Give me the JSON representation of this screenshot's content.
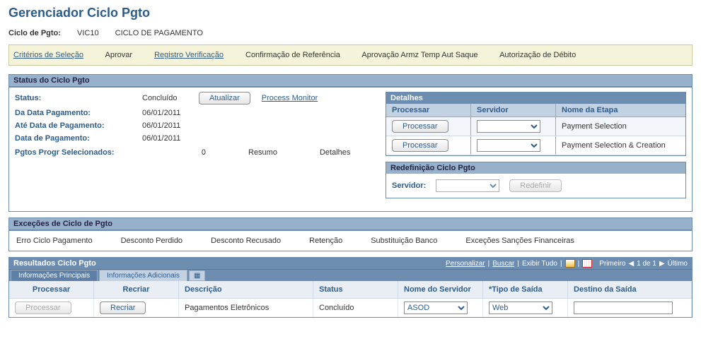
{
  "page": {
    "title": "Gerenciador Ciclo Pgto"
  },
  "cycle": {
    "label": "Ciclo de Pgto:",
    "code": "VIC10",
    "desc": "CICLO DE PAGAMENTO"
  },
  "tabs": {
    "criterios": "Critérios de Seleção",
    "aprovar": "Aprovar",
    "registro": "Registro Verificação",
    "confirmacao": "Confirmação de Referência",
    "aprovacao_armz": "Aprovação Armz Temp Aut Saque",
    "autorizacao_debito": "Autorização de Débito"
  },
  "status": {
    "header": "Status do Ciclo Pgto",
    "labels": {
      "status": "Status:",
      "da_data": "Da Data Pagamento:",
      "ate_data": "Até Data de Pagamento:",
      "data": "Data de Pagamento:",
      "pgtos_progr": "Pgtos Progr Selecionados:"
    },
    "values": {
      "status": "Concluído",
      "da_data": "06/01/2011",
      "ate_data": "06/01/2011",
      "data": "06/01/2011",
      "pgtos_progr": "0"
    },
    "atualizar_label": "Atualizar",
    "process_monitor": "Process Monitor",
    "resumo": "Resumo",
    "detalhes": "Detalhes"
  },
  "details": {
    "header": "Detalhes",
    "cols": {
      "processar": "Processar",
      "servidor": "Servidor",
      "nome_etapa": "Nome da Etapa"
    },
    "rows": [
      {
        "button": "Processar",
        "server": "",
        "step": "Payment Selection"
      },
      {
        "button": "Processar",
        "server": "",
        "step": "Payment Selection & Creation"
      }
    ]
  },
  "redef": {
    "header": "Redefinição Ciclo Pgto",
    "servidor_label": "Servidor:",
    "redefinir_label": "Redefinir"
  },
  "exc": {
    "header": "Exceções de Ciclo de Pgto",
    "items": [
      "Erro Ciclo Pagamento",
      "Desconto Perdido",
      "Desconto Recusado",
      "Retenção",
      "Substituição Banco",
      "Exceções Sanções Financeiras"
    ]
  },
  "results": {
    "header": "Resultados Ciclo Pgto",
    "links": {
      "personalizar": "Personalizar",
      "buscar": "Buscar",
      "exibir_tudo": "Exibir Tudo"
    },
    "nav": {
      "primeiro": "Primeiro",
      "counter": "1 de 1",
      "ultimo": "Último"
    },
    "subtabs": {
      "principais": "Informações Principais",
      "adicionais": "Informações Adicionais"
    },
    "cols": {
      "processar": "Processar",
      "recriar": "Recriar",
      "descricao": "Descrição",
      "status": "Status",
      "nome_servidor": "Nome do Servidor",
      "tipo_saida": "*Tipo de Saída",
      "destino_saida": "Destino da Saída"
    },
    "row": {
      "processar_btn": "Processar",
      "recriar_btn": "Recriar",
      "descricao": "Pagamentos Eletrônicos",
      "status": "Concluído",
      "nome_servidor": "ASOD",
      "tipo_saida": "Web",
      "destino_saida": ""
    }
  }
}
